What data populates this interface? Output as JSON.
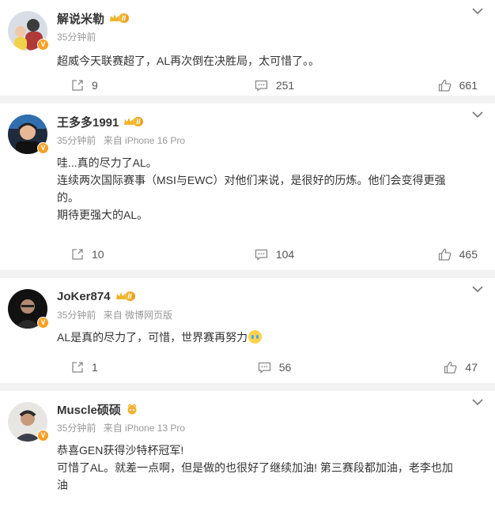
{
  "posts": [
    {
      "name": "解说米勒",
      "level": "II",
      "time": "35分钟前",
      "source": "",
      "lines": [
        "超威今天联赛超了，AL再次倒在决胜局，太可惜了。。"
      ],
      "reposts": "9",
      "comments": "251",
      "likes": "661"
    },
    {
      "name": "王多多1991",
      "level": "II",
      "time": "35分钟前",
      "source": "来自 iPhone 16 Pro",
      "lines": [
        "哇...真的尽力了AL。",
        "连续两次国际赛事（MSI与EWC）对他们来说，是很好的历炼。他们会变得更强",
        "的。",
        "期待更强大的AL。"
      ],
      "reposts": "10",
      "comments": "104",
      "likes": "465"
    },
    {
      "name": "JoKer874",
      "level": "II",
      "time": "35分钟前",
      "source": "来自 微博网页版",
      "lines": [
        "AL是真的尽力了，可惜，世界赛再努力"
      ],
      "reposts": "1",
      "comments": "56",
      "likes": "47"
    },
    {
      "name": "Muscle硕硕",
      "level": "",
      "time": "35分钟前",
      "source": "来自 iPhone 13 Pro",
      "lines": [
        "恭喜GEN获得沙特杯冠军!",
        "可惜了AL。就差一点啊，但是做的也很好了继续加油! 第三赛段都加油，老李也加",
        "油"
      ],
      "reposts": "",
      "comments": "",
      "likes": ""
    }
  ],
  "icons": {
    "verified": "verified-v-badge",
    "repost": "repost-icon",
    "comment": "comment-icon",
    "like": "thumbs-up-icon",
    "menu": "chevron-down-icon",
    "crying_emoji": "crying-emoji-icon"
  },
  "colors": {
    "verified_badge": "#f7a023",
    "level_badge": "#e89b1b",
    "meta_text": "#999999",
    "background": "#f2f2f2"
  }
}
